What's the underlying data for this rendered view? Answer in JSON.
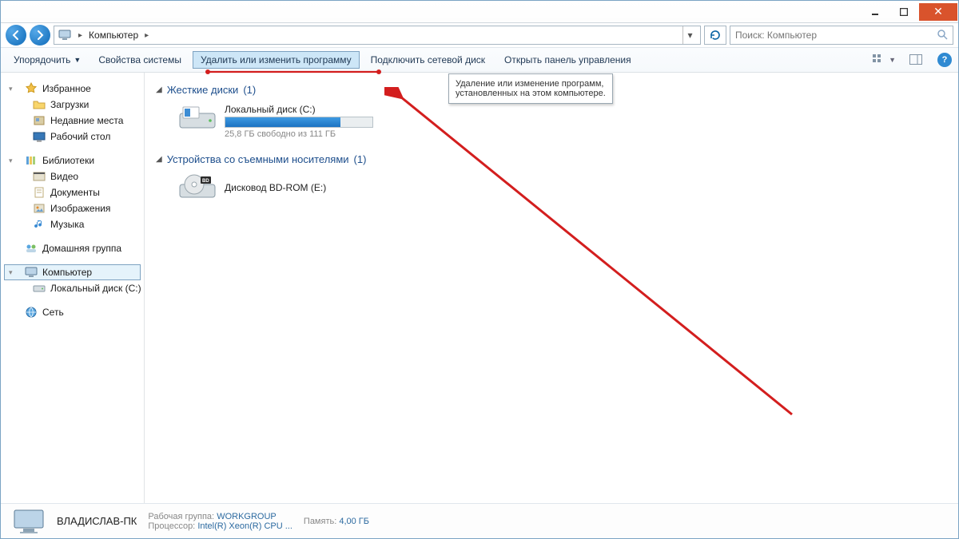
{
  "breadcrumb": {
    "root_label": "Компьютер"
  },
  "search": {
    "placeholder": "Поиск: Компьютер"
  },
  "toolbar": {
    "organize": "Упорядочить",
    "system_properties": "Свойства системы",
    "uninstall": "Удалить или изменить программу",
    "map_drive": "Подключить сетевой диск",
    "control_panel": "Открыть панель управления"
  },
  "tooltip": {
    "text": "Удаление или изменение программ, установленных на этом компьютере."
  },
  "sidebar": {
    "favorites": "Избранное",
    "favorites_items": [
      "Загрузки",
      "Недавние места",
      "Рабочий стол"
    ],
    "libraries": "Библиотеки",
    "libraries_items": [
      "Видео",
      "Документы",
      "Изображения",
      "Музыка"
    ],
    "homegroup": "Домашняя группа",
    "computer": "Компьютер",
    "local_disk": "Локальный диск (C:)",
    "network": "Сеть"
  },
  "sections": {
    "hard_disks": {
      "title": "Жесткие диски",
      "count": "(1)"
    },
    "removable": {
      "title": "Устройства со съемными носителями",
      "count": "(1)"
    }
  },
  "drive_c": {
    "name": "Локальный диск (C:)",
    "free_text": "25,8 ГБ свободно из 111 ГБ"
  },
  "drive_e": {
    "name": "Дисковод BD-ROM (E:)"
  },
  "status": {
    "pc_name": "ВЛАДИСЛАВ-ПК",
    "workgroup_label": "Рабочая группа:",
    "workgroup_value": "WORKGROUP",
    "memory_label": "Память:",
    "memory_value": "4,00 ГБ",
    "cpu_label": "Процессор:",
    "cpu_value": "Intel(R) Xeon(R) CPU    ..."
  }
}
